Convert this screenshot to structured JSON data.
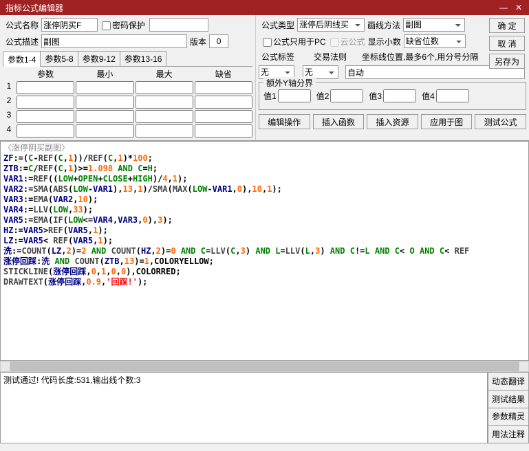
{
  "window": {
    "title": "指标公式编辑器",
    "min": "—",
    "close": "✕"
  },
  "fields": {
    "name_lbl": "公式名称",
    "name_val": "涨停阴买F",
    "pwd_lbl": "密码保护",
    "desc_lbl": "公式描述",
    "desc_val": "副图",
    "ver_lbl": "版本",
    "ver_val": "0",
    "type_lbl": "公式类型",
    "type_val": "涨停后阴线买",
    "draw_lbl": "画线方法",
    "draw_val": "副图",
    "pc_only_lbl": "公式只用于PC",
    "cloud_lbl": "云公式",
    "dec_lbl": "显示小数",
    "dec_val": "缺省位数",
    "tag_lbl": "公式标签",
    "tag_val": "无",
    "trade_lbl": "交易法则",
    "trade_val": "无",
    "coord_lbl": "坐标线位置,最多6个,用分号分隔",
    "coord_val": "自动",
    "yaxis_lbl": "额外Y轴分界",
    "y1": "值1",
    "y2": "值2",
    "y3": "值3",
    "y4": "值4"
  },
  "tabs": [
    "参数1-4",
    "参数5-8",
    "参数9-12",
    "参数13-16"
  ],
  "param_hd": [
    "参数",
    "最小",
    "最大",
    "缺省"
  ],
  "buttons": {
    "ok": "确 定",
    "cancel": "取 消",
    "saveas": "另存为",
    "edit_op": "编辑操作",
    "ins_fn": "插入函数",
    "ins_res": "插入资源",
    "apply": "应用于图",
    "test": "测试公式",
    "side": [
      "动态翻译",
      "测试结果",
      "参数精灵",
      "用法注释"
    ]
  },
  "status": "测试通过! 代码长度:531,输出线个数:3",
  "chart_data": {
    "type": "table",
    "title": "〈涨停阴买副图〉",
    "lines": [
      "ZF:=(C-REF(C,1))/REF(C,1)*100;",
      "ZTB:=C/REF(C,1)>=1.098 AND C=H;",
      "VAR1:=REF((LOW+OPEN+CLOSE+HIGH)/4,1);",
      "VAR2:=SMA(ABS(LOW-VAR1),13,1)/SMA(MAX(LOW-VAR1,0),10,1);",
      "VAR3:=EMA(VAR2,10);",
      "VAR4:=LLV(LOW,33);",
      "VAR5:=EMA(IF(LOW<=VAR4,VAR3,0),3);",
      "HZ:=VAR5>REF(VAR5,1);",
      "LZ:=VAR5< REF(VAR5,1);",
      "洗:=COUNT(LZ,2)=2 AND COUNT(HZ,2)=0 AND C=LLV(C,3) AND L=LLV(L,3) AND C!=L AND C< O AND C< REF",
      "涨停回踩:洗 AND COUNT(ZTB,13)=1,COLORYELLOW;",
      "STICKLINE(涨停回踩,0,1,0,0),COLORRED;",
      "DRAWTEXT(涨停回踩,0.9,'回踩!');"
    ]
  }
}
